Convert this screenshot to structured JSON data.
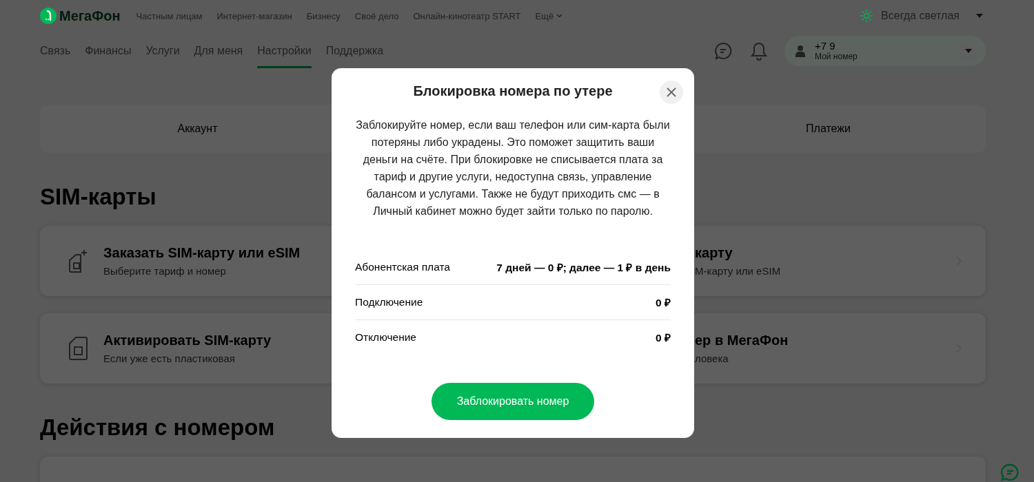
{
  "header": {
    "logo": "МегаФон",
    "top_nav": [
      "Частным лицам",
      "Интернет-магазин",
      "Бизнесу",
      "Своё дело",
      "Онлайн-кинотеатр START"
    ],
    "more": "Ещё",
    "theme": "Всегда светлая"
  },
  "main_nav": [
    {
      "label": "Связь",
      "selected": false
    },
    {
      "label": "Финансы",
      "selected": false
    },
    {
      "label": "Услуги",
      "selected": false
    },
    {
      "label": "Для меня",
      "selected": false
    },
    {
      "label": "Настройки",
      "selected": true
    },
    {
      "label": "Поддержка",
      "selected": false
    }
  ],
  "account": {
    "phone": "+7 9",
    "label": "Мой номер"
  },
  "tabs": [
    {
      "label": "Аккаунт"
    },
    {
      "label": "Платежи"
    }
  ],
  "sections": [
    {
      "title": "SIM-карты",
      "cards": [
        {
          "kind": "left",
          "title": "Заказать SIM-карту или eSIM",
          "subtitle": "Выберите тариф и номер"
        },
        {
          "kind": "right",
          "title": "карту",
          "subtitle": "M-карту или eSIM"
        },
        {
          "kind": "left",
          "title": "Активировать SIM-карту",
          "subtitle": "Если уже есть пластиковая"
        },
        {
          "kind": "right",
          "title": "ер в МегаФон",
          "subtitle": "ловека"
        }
      ]
    },
    {
      "title": "Действия с номером"
    }
  ],
  "modal": {
    "title": "Блокировка номера по утере",
    "text": "Заблокируйте номер, если ваш телефон или сим-карта были потеряны либо украдены. Это поможет защитить ваши деньги на счёте. При блокировке не списывается плата за тариф и другие услуги, недоступна связь, управление балансом и услугами. Также не будут приходить смс — в Личный кабинет можно будет зайти только по паролю.",
    "rows": [
      {
        "label": "Абонентская плата",
        "value": "7 дней — 0 ₽; далее — 1 ₽ в день"
      },
      {
        "label": "Подключение",
        "value": "0 ₽"
      },
      {
        "label": "Отключение",
        "value": "0 ₽"
      }
    ],
    "button": "Заблокировать номер"
  }
}
